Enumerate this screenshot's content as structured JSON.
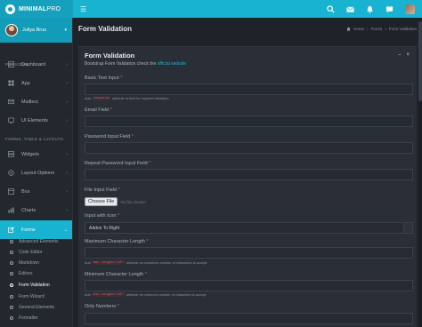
{
  "brand": {
    "bold": "MINIMAL",
    "thin": "PRO"
  },
  "navbar": {
    "toggle_icon": "hamburger-icon",
    "icons": [
      "search-icon",
      "mail-icon",
      "bell-icon",
      "flag-icon"
    ]
  },
  "user": {
    "name": "Juliya Brus"
  },
  "sidebar": {
    "section_personal": "PERSONAL",
    "section_forms": "FORMS, TABLE & LAYOUTS",
    "items": [
      {
        "label": "Dashboard",
        "icon": "dashboard-icon"
      },
      {
        "label": "App",
        "icon": "grid-icon"
      },
      {
        "label": "Mailbox",
        "icon": "mail-icon"
      },
      {
        "label": "UI Elements",
        "icon": "tv-icon"
      },
      {
        "label": "Widgets",
        "icon": "widgets-icon"
      },
      {
        "label": "Layout Options",
        "icon": "layout-icon"
      },
      {
        "label": "Box",
        "icon": "box-icon"
      },
      {
        "label": "Charts",
        "icon": "chart-icon"
      },
      {
        "label": "Forms",
        "icon": "edit-icon"
      }
    ],
    "sub_items": [
      {
        "label": "Advanced Elements"
      },
      {
        "label": "Code Editor"
      },
      {
        "label": "Markdown"
      },
      {
        "label": "Editors"
      },
      {
        "label": "Form Validation"
      },
      {
        "label": "Form Wizard"
      },
      {
        "label": "General Elements"
      },
      {
        "label": "Formatter"
      }
    ]
  },
  "header": {
    "title": "Form Validation",
    "breadcrumb": [
      "Home",
      "Forms",
      "Form Validation"
    ]
  },
  "box": {
    "title": "Form Validation",
    "subtitle_prefix": "Bootstrap Form Validation check the",
    "subtitle_link": "official website",
    "fields": {
      "basic_text": "Basic Text Input",
      "email": "Email Field",
      "password": "Password Input Field",
      "repeat_password": "Repeat Password Input Field",
      "file": "File Input Field",
      "with_icon": "Input with Icon",
      "max_length": "Maximum Character Length",
      "min_length": "Minimum Character Length",
      "only_numbers": "Only Numbers"
    },
    "required_mark": "*",
    "help_required_code": "required",
    "help_required_text": "attribute to field for required validation.",
    "file_button": "Choose File",
    "file_status": "No file chosen",
    "icon_input_value": "Addon To Right",
    "help_max_prefix": "Add",
    "help_max_code": "max-length=\"10\"",
    "help_max_text": "attribute for maximum number of characters to accept.",
    "help_min_prefix": "Add",
    "help_min_code": "min-length=\"10\"",
    "help_min_text": "attribute for minimum number of characters to accept."
  },
  "colors": {
    "accent": "#17b3d1",
    "brand": "#16a0bd",
    "required": "#e4575c"
  }
}
